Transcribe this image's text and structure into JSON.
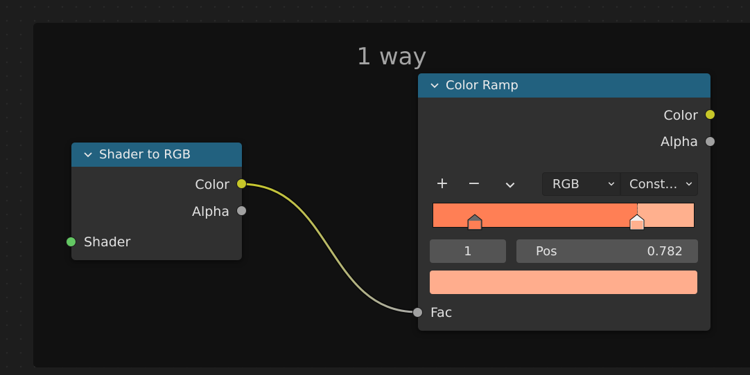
{
  "frame": {
    "label": "1 way"
  },
  "node_shader_to_rgb": {
    "title": "Shader to RGB",
    "outputs": {
      "color": "Color",
      "alpha": "Alpha"
    },
    "inputs": {
      "shader": "Shader"
    }
  },
  "node_color_ramp": {
    "title": "Color Ramp",
    "outputs": {
      "color": "Color",
      "alpha": "Alpha"
    },
    "toolbar": {
      "add": "+",
      "remove": "−",
      "menu": "⌄"
    },
    "color_mode": "RGB",
    "interpolation": "Const…",
    "active_stop_index": "1",
    "pos_label": "Pos",
    "pos_value": "0.782",
    "stops": [
      {
        "position": 0.16,
        "color": "#ff7f55"
      },
      {
        "position": 0.782,
        "color": "#ffb08e"
      }
    ],
    "active_color": "#ffad8d",
    "inputs": {
      "fac": "Fac"
    }
  },
  "colors": {
    "header": "#22617f",
    "socket_color": "#c7c729",
    "socket_float": "#a1a1a1",
    "socket_shader": "#63c763"
  }
}
